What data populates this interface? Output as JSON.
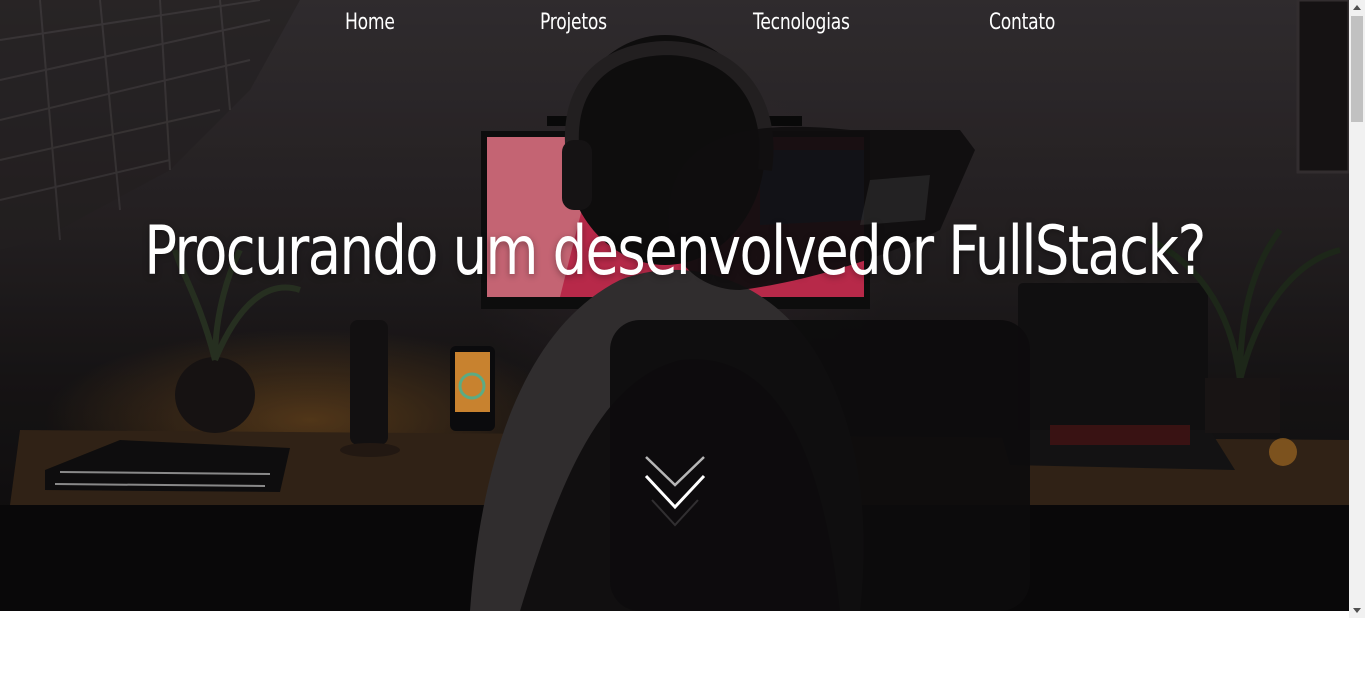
{
  "nav": {
    "items": [
      {
        "label": "Home"
      },
      {
        "label": "Projetos"
      },
      {
        "label": "Tecnologias"
      },
      {
        "label": "Contato"
      }
    ]
  },
  "hero": {
    "headline": "Procurando um desenvolvedor FullStack?",
    "scroll_icon": "double-chevron-down-icon",
    "background_image": "person-with-headphones-at-desk-photo"
  },
  "colors": {
    "text": "#ffffff",
    "page_background": "#ffffff",
    "scrollbar_track": "#f1f1f1",
    "scrollbar_thumb": "#c1c1c1"
  }
}
